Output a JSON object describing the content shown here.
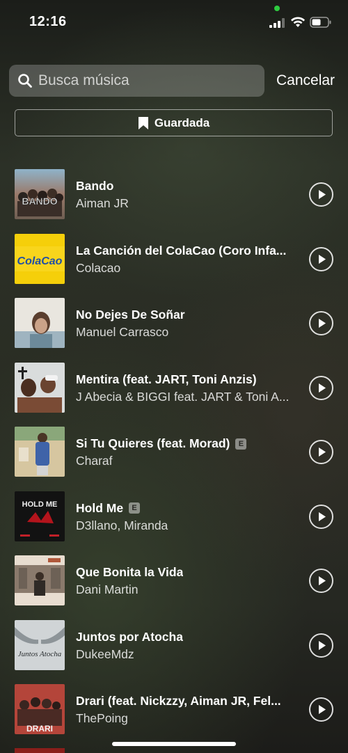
{
  "status_bar": {
    "time": "12:16",
    "privacy_dot_color": "#2ecc40"
  },
  "search": {
    "placeholder": "Busca música",
    "cancel_label": "Cancelar"
  },
  "saved_button": {
    "label": "Guardada"
  },
  "songs": [
    {
      "title": "Bando",
      "artist": "Aiman JR",
      "explicit": false,
      "cover_text": "BANDO"
    },
    {
      "title": "La Canción del ColaCao (Coro Infa...",
      "artist": "Colacao",
      "explicit": false,
      "cover_text": "ColaCao"
    },
    {
      "title": "No Dejes De Soñar",
      "artist": "Manuel Carrasco",
      "explicit": false,
      "cover_text": ""
    },
    {
      "title": "Mentira (feat. JART, Toni Anzis)",
      "artist": "J Abecia & BIGGI feat. JART & Toni A...",
      "explicit": false,
      "cover_text": ""
    },
    {
      "title": "Si Tu Quieres (feat. Morad)",
      "artist": "Charaf",
      "explicit": true,
      "cover_text": ""
    },
    {
      "title": "Hold Me",
      "artist": "D3llano, Miranda",
      "explicit": true,
      "cover_text": "HOLD ME"
    },
    {
      "title": "Que Bonita la Vida",
      "artist": "Dani Martin",
      "explicit": false,
      "cover_text": ""
    },
    {
      "title": "Juntos por Atocha",
      "artist": "DukeeMdz",
      "explicit": false,
      "cover_text": "Juntos Atocha"
    },
    {
      "title": "Drari (feat. Nickzzy, Aiman JR, Fel...",
      "artist": "ThePoing",
      "explicit": false,
      "cover_text": "DRARI"
    }
  ],
  "explicit_label": "E"
}
